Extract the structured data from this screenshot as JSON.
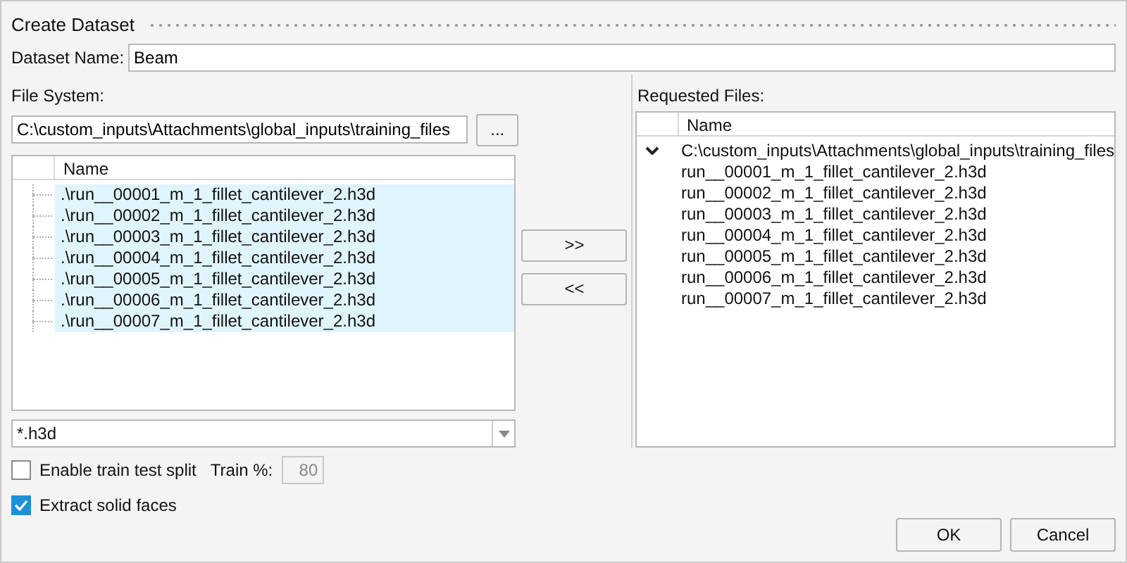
{
  "window": {
    "title": "Create Dataset"
  },
  "dataset_name": {
    "label": "Dataset Name:",
    "value": "Beam"
  },
  "file_system": {
    "label": "File System:",
    "path": "C:\\custom_inputs\\Attachments\\global_inputs\\training_files",
    "browse_button": "...",
    "column": "Name",
    "files": [
      {
        "name": ".\\run__00001_m_1_fillet_cantilever_2.h3d",
        "selected": true
      },
      {
        "name": ".\\run__00002_m_1_fillet_cantilever_2.h3d",
        "selected": true
      },
      {
        "name": ".\\run__00003_m_1_fillet_cantilever_2.h3d",
        "selected": true
      },
      {
        "name": ".\\run__00004_m_1_fillet_cantilever_2.h3d",
        "selected": true
      },
      {
        "name": ".\\run__00005_m_1_fillet_cantilever_2.h3d",
        "selected": true
      },
      {
        "name": ".\\run__00006_m_1_fillet_cantilever_2.h3d",
        "selected": true
      },
      {
        "name": ".\\run__00007_m_1_fillet_cantilever_2.h3d",
        "selected": true
      }
    ],
    "filter": "*.h3d"
  },
  "transfer_buttons": [
    ">>",
    "<<"
  ],
  "train_split": {
    "label": "Enable train test split",
    "checked": false,
    "percent_label": "Train %:",
    "percent_value": "80",
    "percent_disabled": true
  },
  "extract_faces": {
    "label": "Extract solid faces",
    "checked": true
  },
  "requested_files": {
    "label": "Requested Files:",
    "column": "Name",
    "folder": {
      "path": "C:\\custom_inputs\\Attachments\\global_inputs\\training_files",
      "expanded": true,
      "children": [
        {
          "name": "run__00001_m_1_fillet_cantilever_2.h3d"
        },
        {
          "name": "run__00002_m_1_fillet_cantilever_2.h3d"
        },
        {
          "name": "run__00003_m_1_fillet_cantilever_2.h3d"
        },
        {
          "name": "run__00004_m_1_fillet_cantilever_2.h3d"
        },
        {
          "name": "run__00005_m_1_fillet_cantilever_2.h3d"
        },
        {
          "name": "run__00006_m_1_fillet_cantilever_2.h3d"
        },
        {
          "name": "run__00007_m_1_fillet_cantilever_2.h3d"
        }
      ]
    }
  },
  "buttons": [
    "OK",
    "Cancel"
  ]
}
